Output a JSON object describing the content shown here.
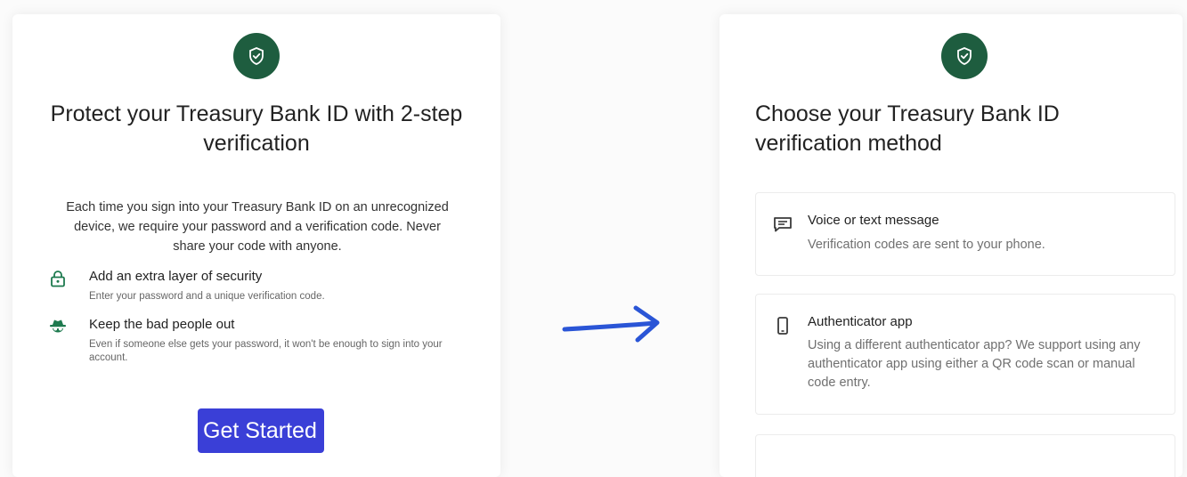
{
  "left_panel": {
    "title": "Protect your Treasury Bank ID with 2-step verification",
    "intro": "Each time you sign into your Treasury Bank ID on an unrecognized device, we require your password and a verification code. Never share your code with anyone.",
    "features": [
      {
        "icon": "lock-icon",
        "heading": "Add an extra layer of security",
        "description": "Enter your password and a unique verification code."
      },
      {
        "icon": "spy-icon",
        "heading": "Keep the bad people out",
        "description": "Even if someone else gets your password, it won't be enough to sign into your account."
      }
    ],
    "button_label": "Get Started"
  },
  "right_panel": {
    "title": "Choose your Treasury Bank ID verification method",
    "options": [
      {
        "icon": "message-icon",
        "title": "Voice or text message",
        "description": "Verification codes are sent to your phone."
      },
      {
        "icon": "phone-icon",
        "title": "Authenticator app",
        "description": "Using a different authenticator app? We support using any authenticator app using either a QR code scan or manual code entry."
      }
    ]
  },
  "colors": {
    "brand_green": "#1e5d3f",
    "button_blue": "#3a3fd7",
    "arrow_blue": "#2a55d6"
  }
}
